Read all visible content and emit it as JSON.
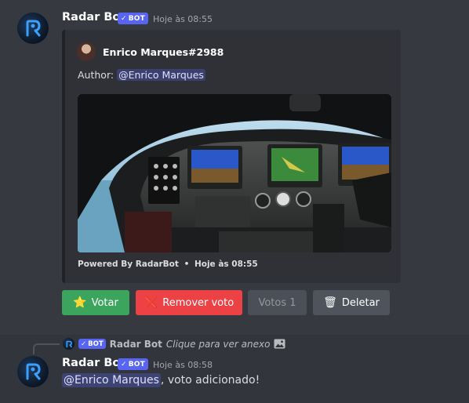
{
  "message1": {
    "username": "Radar Bot",
    "badge": "BOT",
    "badge_check": "✓",
    "timestamp": "Hoje às 08:55",
    "embed": {
      "author_name": "Enrico Marques#2988",
      "description_label": "Author:",
      "description_mention": "@Enrico Marques",
      "image_alt": "cockpit-photo",
      "footer_text": "Powered By RadarBot",
      "footer_sep": "•",
      "footer_time": "Hoje às 08:55"
    },
    "buttons": [
      {
        "label": "Votar",
        "emoji": "⭐",
        "style": "success"
      },
      {
        "label": "Remover voto",
        "emoji": "❌",
        "style": "danger"
      },
      {
        "label": "Votos 1",
        "emoji": "",
        "style": "disabled"
      },
      {
        "label": "Deletar",
        "emoji": "🗑",
        "style": "secondary"
      }
    ]
  },
  "reply": {
    "badge": "BOT",
    "badge_check": "✓",
    "username": "Radar Bot",
    "hint": "Clique para ver anexo",
    "icon": "image-icon"
  },
  "message2": {
    "username": "Radar Bot",
    "badge": "BOT",
    "badge_check": "✓",
    "timestamp": "Hoje às 08:58",
    "mention": "@Enrico Marques",
    "text": ", voto adicionado!"
  },
  "colors": {
    "background": "#36393f",
    "embed": "#2f3136",
    "blurple": "#5865f2",
    "success": "#3ba55d",
    "danger": "#ed4245",
    "secondary": "#4f545c"
  }
}
